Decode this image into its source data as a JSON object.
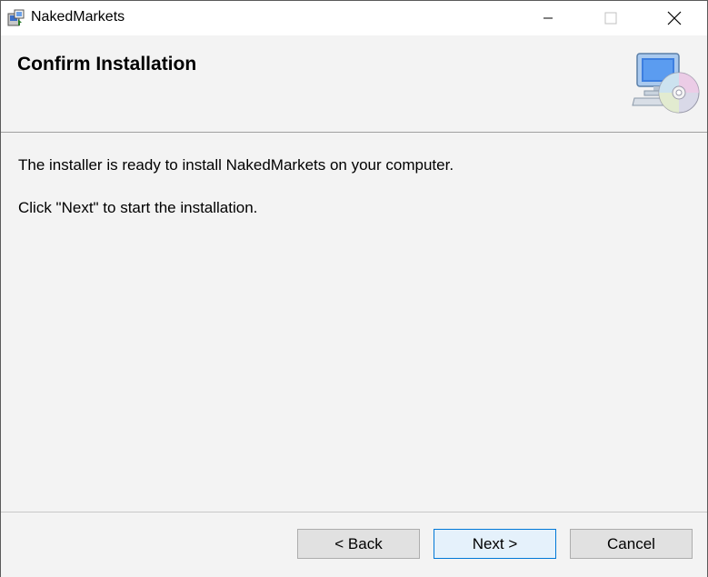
{
  "window": {
    "title": "NakedMarkets",
    "controls": {
      "minimize": "minimize-icon",
      "maximize": "maximize-icon",
      "close": "close-icon"
    }
  },
  "header": {
    "title": "Confirm Installation",
    "art_icon": "computer-disc-icon"
  },
  "content": {
    "line1": "The installer is ready to install NakedMarkets on your computer.",
    "line2": "Click \"Next\" to start the installation."
  },
  "footer": {
    "back_label": "< Back",
    "next_label": "Next >",
    "cancel_label": "Cancel"
  },
  "colors": {
    "accent": "#0078d7",
    "background": "#f3f3f3"
  }
}
